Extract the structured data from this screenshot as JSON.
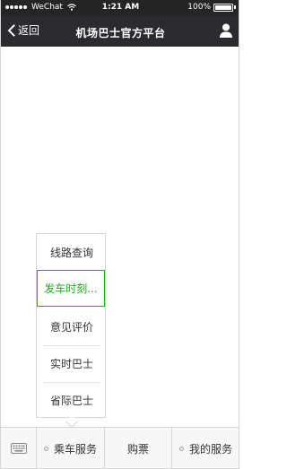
{
  "status_bar": {
    "carrier": "WeChat",
    "time": "1:21 AM",
    "battery": "100%"
  },
  "nav": {
    "back_label": "返回",
    "title": "机场巴士官方平台",
    "icons": {
      "back": "chevron-left-icon",
      "user": "user-icon"
    }
  },
  "popup_menu": {
    "items": [
      {
        "label": "线路查询"
      },
      {
        "label": "发车时刻..."
      },
      {
        "label": "意见评价"
      },
      {
        "label": "实时巴士"
      },
      {
        "label": "省际巴士"
      }
    ],
    "active_index": 1,
    "accent_color": "#1aad19"
  },
  "bottom_menu": {
    "keyboard_icon": "keyboard-icon",
    "tabs": [
      {
        "label": "乘车服务",
        "has_submenu": true
      },
      {
        "label": "购票",
        "has_submenu": false
      },
      {
        "label": "我的服务",
        "has_submenu": true
      }
    ]
  },
  "colors": {
    "nav_background": "#2b2b2f",
    "status_background": "#252525",
    "menu_background": "#f7f7f7"
  }
}
